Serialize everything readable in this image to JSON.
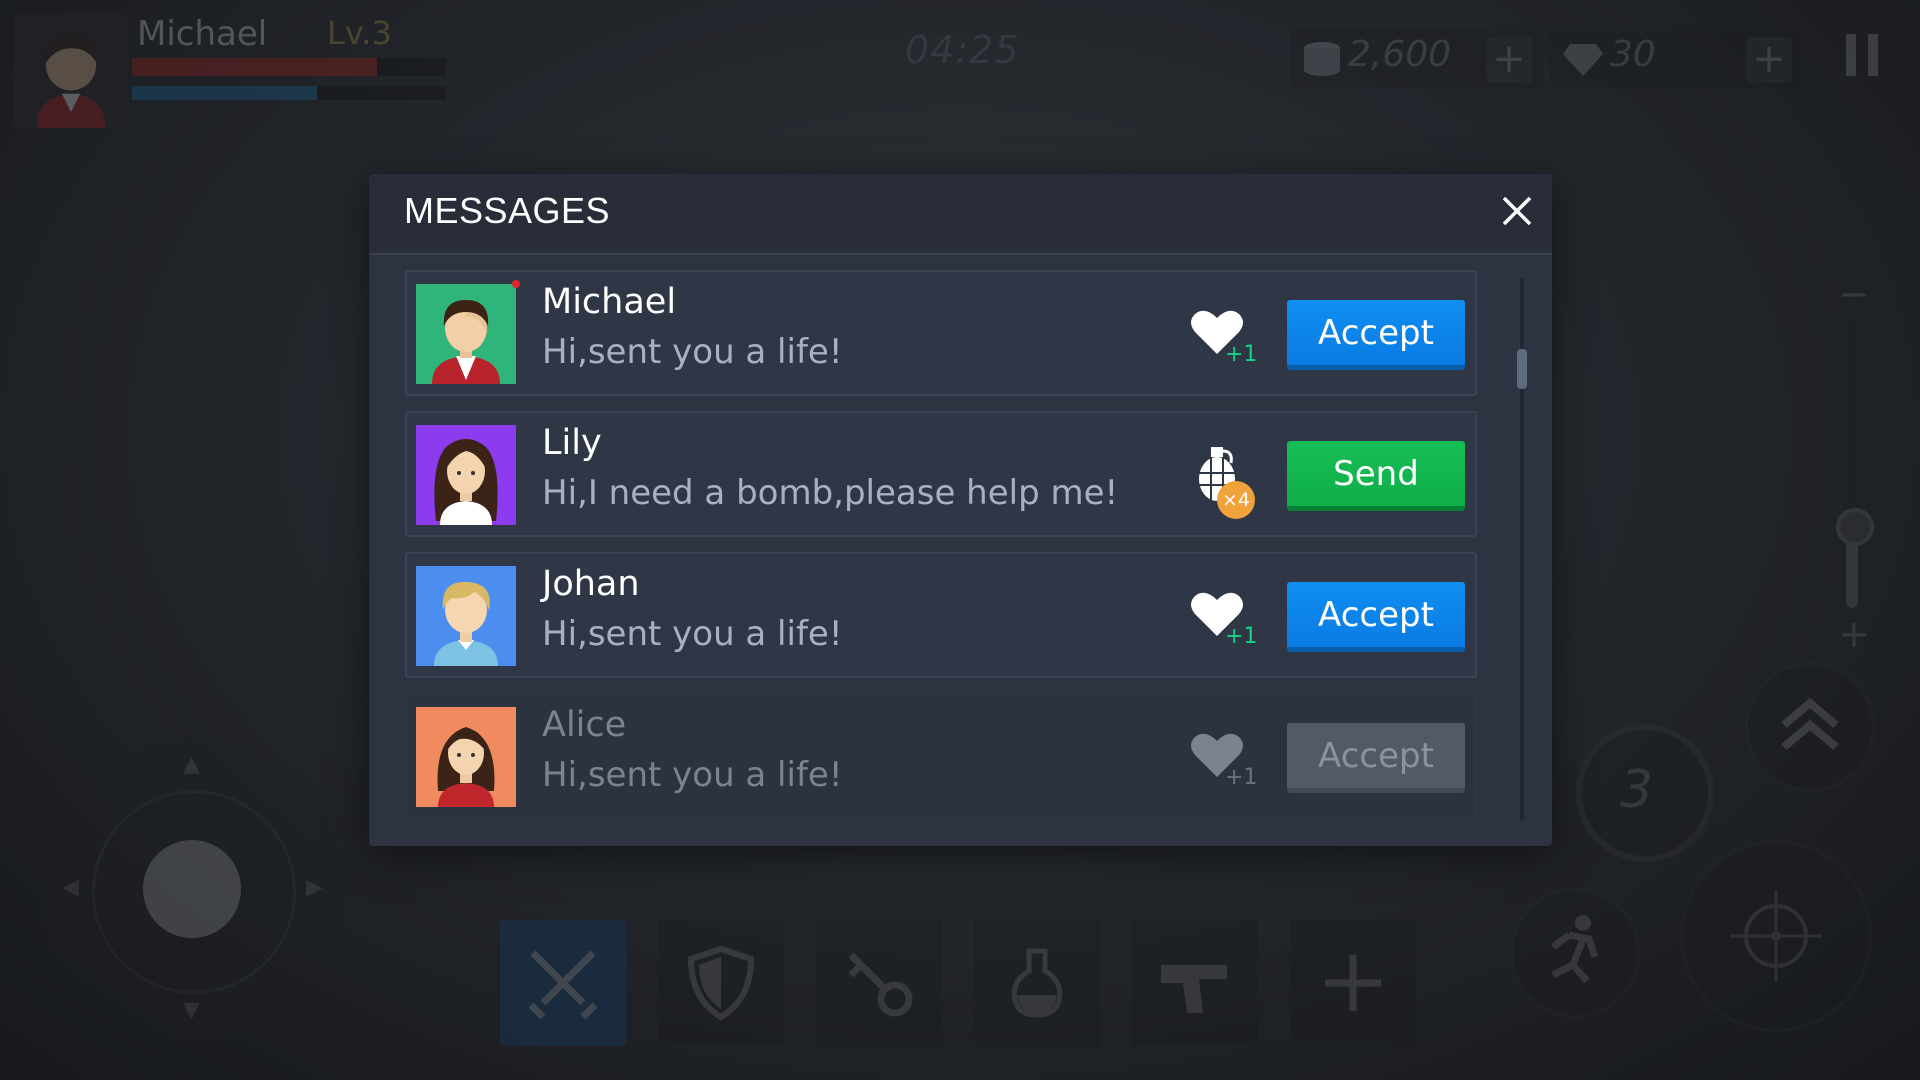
{
  "hud": {
    "player_name": "Michael",
    "level": "Lv.3",
    "health_fraction": 0.78,
    "mana_fraction": 0.59,
    "timer": "04:25",
    "coins": "2,600",
    "gems": "30",
    "grenade_count": "3",
    "toolbar": [
      "swords-icon",
      "shield-icon",
      "key-icon",
      "potion-icon",
      "pistol-icon",
      "plus-icon"
    ],
    "colors": {
      "health": "#b0231d",
      "mana": "#1a6ea6",
      "selected_slot": "#174a80"
    }
  },
  "dialog": {
    "title": "MESSAGES",
    "close_icon": "close-icon",
    "messages": [
      {
        "name": "Michael",
        "text": "Hi,sent you a life!",
        "gift_icon": "heart-icon",
        "gift_count": "+1",
        "action": "Accept",
        "unread": true,
        "avatar_bg": "#2fb57a"
      },
      {
        "name": "Lily",
        "text": "Hi,I need a bomb,please help me!",
        "gift_icon": "grenade-icon",
        "gift_count": "×4",
        "action": "Send",
        "avatar_bg": "#8c3bef"
      },
      {
        "name": "Johan",
        "text": "Hi,sent you a life!",
        "gift_icon": "heart-icon",
        "gift_count": "+1",
        "action": "Accept",
        "avatar_bg": "#4b8ef0"
      },
      {
        "name": "Alice",
        "text": "Hi,sent you a life!",
        "gift_icon": "heart-icon",
        "gift_count": "+1",
        "action": "Accept",
        "disabled": true,
        "avatar_bg": "#f08b5f"
      }
    ],
    "colors": {
      "accept": "#0a82ea",
      "send": "#12b24d",
      "disabled": "#535a67"
    }
  }
}
